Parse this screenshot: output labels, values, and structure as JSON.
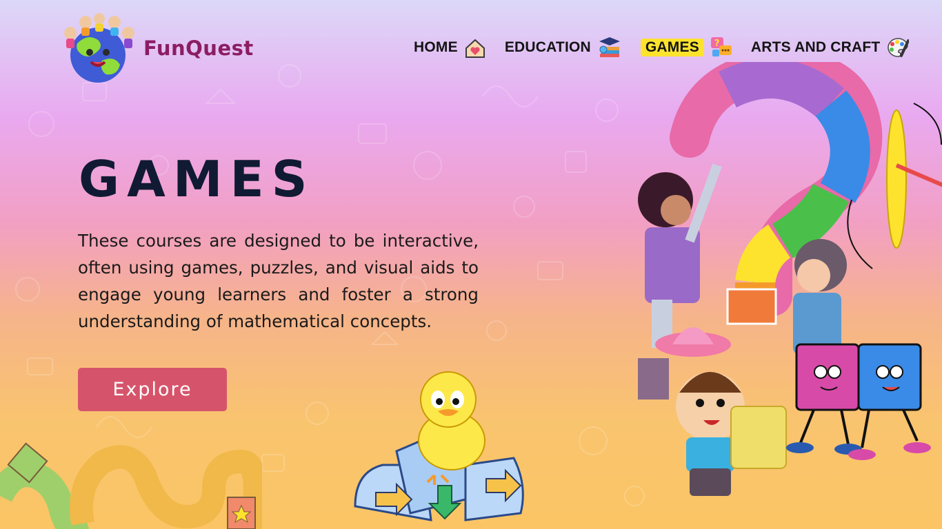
{
  "brand": {
    "name": "FunQuest",
    "logo_icon": "globe-with-kids-icon"
  },
  "nav": {
    "items": [
      {
        "label": "HOME",
        "icon": "home-heart-icon"
      },
      {
        "label": "EDUCATION",
        "icon": "graduation-books-icon"
      },
      {
        "label": "GAMES",
        "icon": "question-chat-icon",
        "active": true
      },
      {
        "label": "ARTS AND CRAFT",
        "icon": "paint-palette-icon"
      }
    ]
  },
  "hero": {
    "title": "GAMES",
    "description": "These courses are designed to be interactive, often using games, puzzles, and visual aids to engage young learners and foster a strong understanding of mathematical concepts.",
    "button_label": "Explore"
  },
  "colors": {
    "button": "#d6546b",
    "title": "#111a33",
    "active_nav_highlight": "#fde32d",
    "brand": "#8c1d62"
  }
}
